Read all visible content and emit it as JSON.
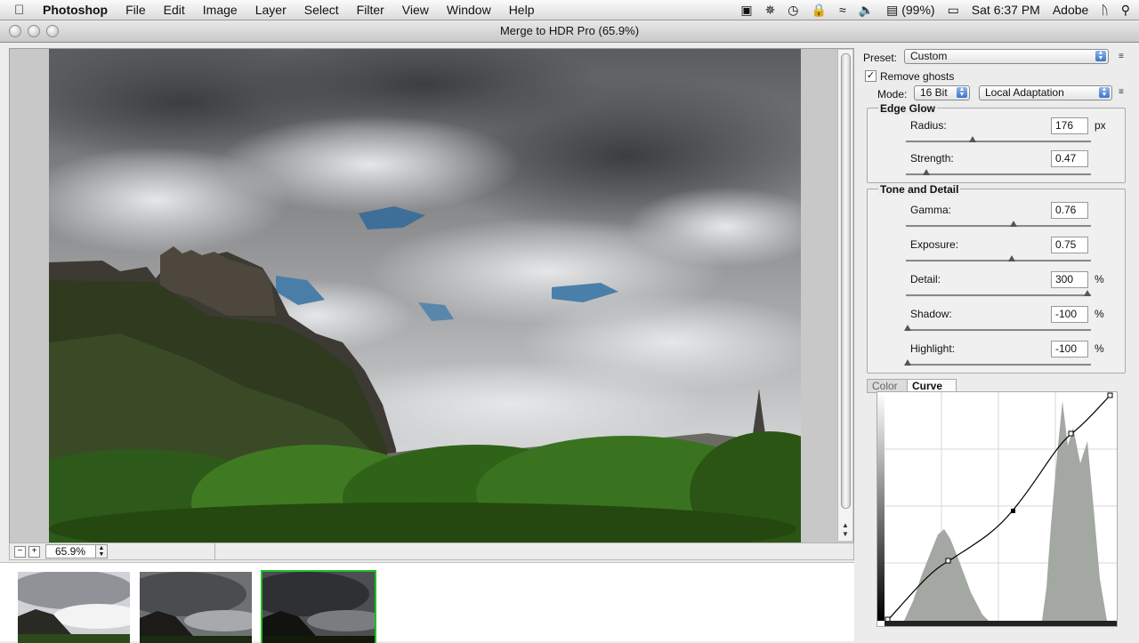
{
  "menubar": {
    "apple": "",
    "items": [
      "Photoshop",
      "File",
      "Edit",
      "Image",
      "Layer",
      "Select",
      "Filter",
      "View",
      "Window",
      "Help"
    ],
    "status": {
      "battery": "(99%)",
      "clock": "Sat 6:37 PM",
      "user": "Adobe"
    }
  },
  "window": {
    "title": "Merge to HDR Pro (65.9%)"
  },
  "zoom": {
    "value": "65.9%",
    "minus": "−",
    "plus": "+"
  },
  "panel": {
    "preset_label": "Preset:",
    "preset_value": "Custom",
    "remove_ghosts_label": "Remove ghosts",
    "remove_ghosts_checked": true,
    "mode_label": "Mode:",
    "bit_depth": "16 Bit",
    "method": "Local Adaptation",
    "edge_glow": {
      "title": "Edge Glow",
      "radius": {
        "label": "Radius:",
        "value": "176",
        "unit": "px",
        "position": 0.36
      },
      "strength": {
        "label": "Strength:",
        "value": "0.47",
        "unit": "",
        "position": 0.11
      }
    },
    "tone_detail": {
      "title": "Tone and Detail",
      "gamma": {
        "label": "Gamma:",
        "value": "0.76",
        "unit": "",
        "position": 0.58
      },
      "exposure": {
        "label": "Exposure:",
        "value": "0.75",
        "unit": "",
        "position": 0.57
      },
      "detail": {
        "label": "Detail:",
        "value": "300",
        "unit": "%",
        "position": 0.98
      },
      "shadow": {
        "label": "Shadow:",
        "value": "-100",
        "unit": "%",
        "position": 0.01
      },
      "highlight": {
        "label": "Highlight:",
        "value": "-100",
        "unit": "%",
        "position": 0.01
      }
    },
    "tabs": {
      "color": "Color",
      "curve": "Curve"
    }
  },
  "colors": {
    "selection": "#1fbf27",
    "accent": "#3a74c9"
  }
}
